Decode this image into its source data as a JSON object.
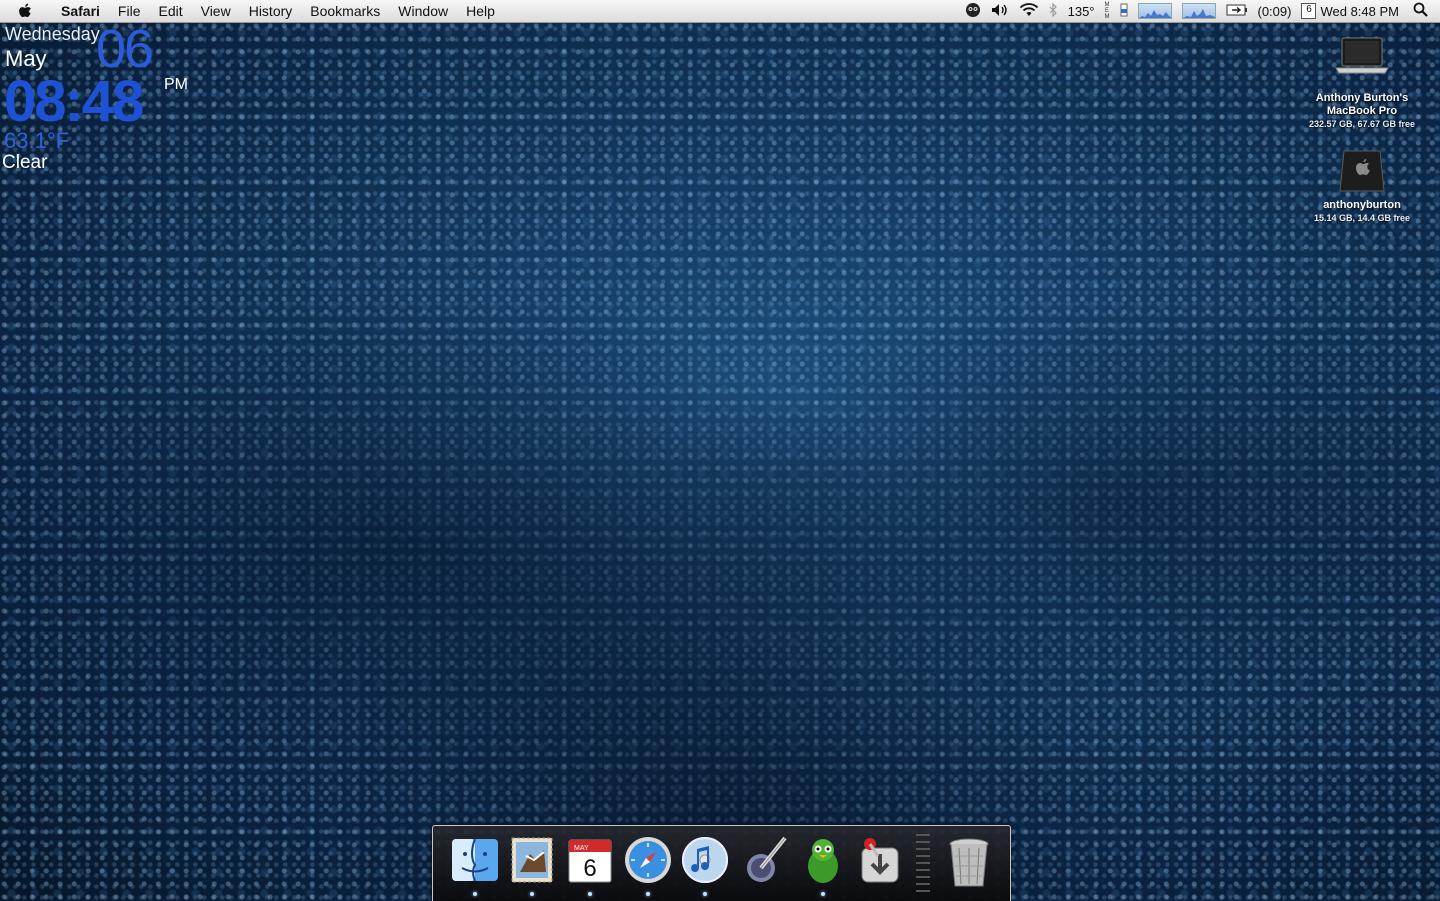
{
  "menubar": {
    "app_name": "Safari",
    "items": [
      "File",
      "Edit",
      "View",
      "History",
      "Bookmarks",
      "Window",
      "Help"
    ],
    "status": {
      "temperature": "135°",
      "battery_time": "(0:09)",
      "calendar_day": "6",
      "clock": "Wed 8:48 PM"
    }
  },
  "clock_widget": {
    "day": "Wednesday",
    "month": "May",
    "date": "06",
    "time": "08:48",
    "ampm": "PM",
    "temperature": "63.1°F",
    "condition": "Clear"
  },
  "desktop": {
    "icons": [
      {
        "name_line1": "Anthony Burton's",
        "name_line2": "MacBook Pro",
        "info": "232.57 GB, 67.67 GB free"
      },
      {
        "name_line1": "anthonyburton",
        "name_line2": "",
        "info": "15.14 GB, 14.4 GB free"
      }
    ]
  },
  "dock": {
    "items": [
      {
        "icon": "finder-icon",
        "running": true
      },
      {
        "icon": "mail-icon",
        "running": true
      },
      {
        "icon": "ical-icon",
        "running": true,
        "month": "MAY",
        "day": "6"
      },
      {
        "icon": "safari-icon",
        "running": true
      },
      {
        "icon": "itunes-icon",
        "running": true
      },
      {
        "icon": "script-editor-icon",
        "running": false
      },
      {
        "icon": "adium-icon",
        "running": true
      },
      {
        "icon": "transmission-icon",
        "running": false
      },
      {
        "icon": "trash-icon",
        "running": false
      }
    ]
  }
}
